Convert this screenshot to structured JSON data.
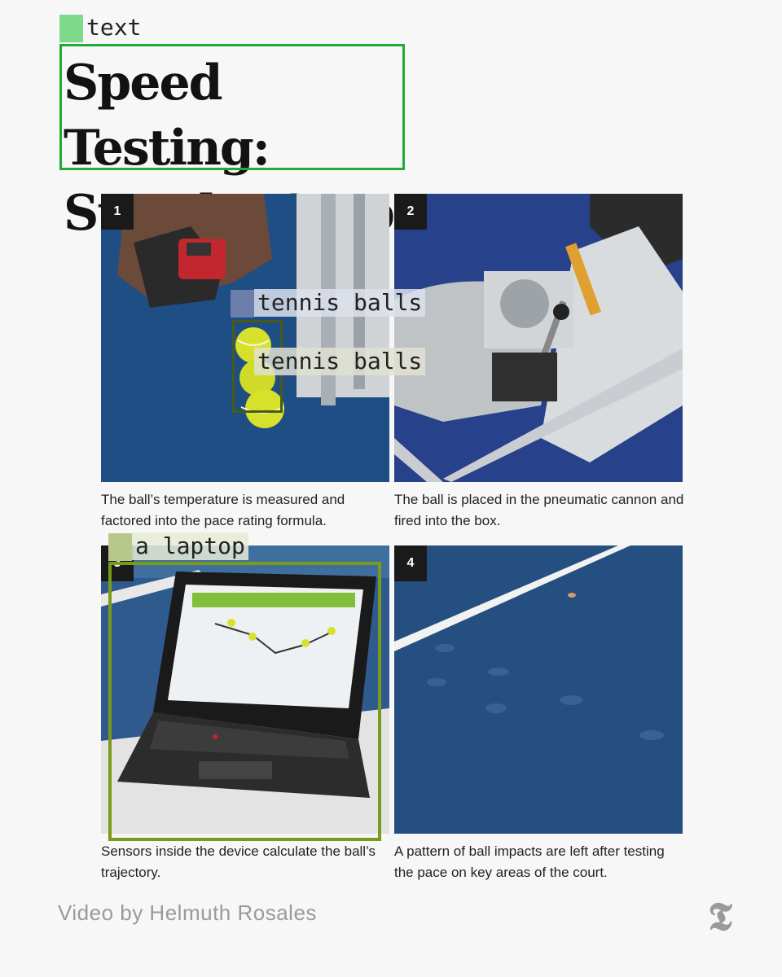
{
  "annotations": {
    "text_label": "text",
    "tennis_balls_label_1": "tennis balls",
    "tennis_balls_label_2": "tennis balls",
    "laptop_label": "a laptop"
  },
  "title": "Speed Testing: Step-by-Step",
  "panels": [
    {
      "number": "1",
      "caption": "The ball’s temperature is measured and factored into the pace rating formula."
    },
    {
      "number": "2",
      "caption": "The ball is placed in the pneumatic cannon and fired into the box."
    },
    {
      "number": "3",
      "caption": "Sensors inside the device calculate the ball’s trajectory."
    },
    {
      "number": "4",
      "caption": "A pattern of ball impacts are left after testing the pace on key areas of the court."
    }
  ],
  "credit": "Video by Helmuth Rosales",
  "logo_glyph": "𝕿",
  "colors": {
    "court_blue": "#1f4e84",
    "annotation_green": "#22aa33",
    "annotation_olive": "#7a9a1a",
    "annotation_dark_olive": "#4a5a1a"
  }
}
